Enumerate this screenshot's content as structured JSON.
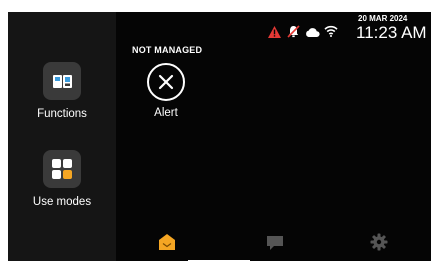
{
  "sidebar": {
    "items": [
      {
        "label": "Functions",
        "icon": "intercom-devices-icon"
      },
      {
        "label": "Use modes",
        "icon": "modes-grid-icon"
      }
    ]
  },
  "status": {
    "date": "20 MAR 2024",
    "time": "11:23 AM",
    "icons": [
      "warning-icon",
      "notifications-muted-icon",
      "cloud-icon",
      "wifi-icon"
    ]
  },
  "main": {
    "badge": "NOT MANAGED",
    "alert_label": "Alert"
  },
  "bottom_nav": {
    "items": [
      {
        "name": "home",
        "icon": "home-icon",
        "active": true
      },
      {
        "name": "messages",
        "icon": "message-icon",
        "active": false
      },
      {
        "name": "settings",
        "icon": "gear-icon",
        "active": false
      }
    ]
  },
  "colors": {
    "accent": "#f5a623",
    "warning": "#e53935",
    "sidebar_bg": "#151515",
    "screen_bg": "#050505"
  }
}
